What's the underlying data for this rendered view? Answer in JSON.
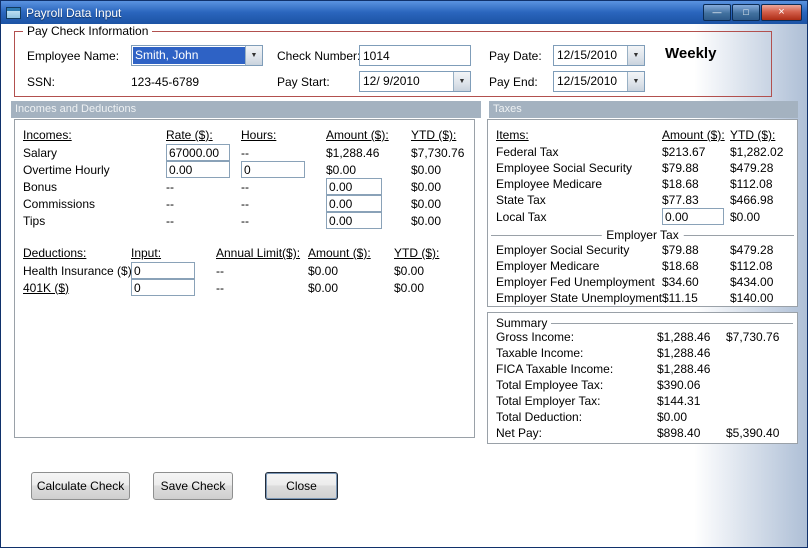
{
  "window": {
    "title": "Payroll Data Input"
  },
  "icons": {
    "dropdown_arrow": "▼",
    "minimize": "—",
    "maximize": "□",
    "close": "×"
  },
  "colors": {
    "titlebar_blue": "#2a65bd",
    "group_border_red": "#b2504e",
    "section_header_bg": "#a4b2c0",
    "selection_blue": "#2e62c5"
  },
  "paycheck": {
    "group_label": "Pay Check Information",
    "fields": {
      "employee_name": {
        "label": "Employee Name:",
        "value": "Smith, John"
      },
      "ssn": {
        "label": "SSN:",
        "value": "123-45-6789"
      },
      "check_number": {
        "label": "Check Number:",
        "value": "1014"
      },
      "pay_start": {
        "label": "Pay Start:",
        "value": "12/ 9/2010"
      },
      "pay_date": {
        "label": "Pay Date:",
        "value": "12/15/2010"
      },
      "pay_end": {
        "label": "Pay End:",
        "value": "12/15/2010"
      }
    },
    "frequency": "Weekly"
  },
  "section_headers": {
    "incomes_deductions": "Incomes and Deductions",
    "taxes": "Taxes"
  },
  "incomes": {
    "headers": {
      "item": "Incomes:",
      "rate": "Rate ($):",
      "hours": "Hours:",
      "amount": "Amount ($):",
      "ytd": "YTD ($):"
    },
    "salary": {
      "label": "Salary",
      "rate": "67000.00",
      "hours": "--",
      "amount": "$1,288.46",
      "ytd": "$7,730.76"
    },
    "overtime": {
      "label": "Overtime Hourly",
      "rate": "0.00",
      "hours": "0",
      "amount": "$0.00",
      "ytd": "$0.00"
    },
    "bonus": {
      "label": "Bonus",
      "rate": "--",
      "hours": "--",
      "amount": "0.00",
      "ytd": "$0.00"
    },
    "commissions": {
      "label": "Commissions",
      "rate": "--",
      "hours": "--",
      "amount": "0.00",
      "ytd": "$0.00"
    },
    "tips": {
      "label": "Tips",
      "rate": "--",
      "hours": "--",
      "amount": "0.00",
      "ytd": "$0.00"
    }
  },
  "deductions": {
    "headers": {
      "item": "Deductions:",
      "input": "Input:",
      "limit": "Annual Limit($):",
      "amount": "Amount ($):",
      "ytd": "YTD ($):"
    },
    "health": {
      "label": "Health Insurance ($)",
      "input": "0",
      "limit": "--",
      "amount": "$0.00",
      "ytd": "$0.00"
    },
    "k401": {
      "label": "401K ($)",
      "input": "0",
      "limit": "--",
      "amount": "$0.00",
      "ytd": "$0.00"
    }
  },
  "taxes": {
    "headers": {
      "item": "Items:",
      "amount": "Amount ($):",
      "ytd": "YTD ($):"
    },
    "rows": [
      {
        "label": "Federal Tax",
        "amount": "$213.67",
        "ytd": "$1,282.02"
      },
      {
        "label": "Employee Social Security",
        "amount": "$79.88",
        "ytd": "$479.28"
      },
      {
        "label": "Employee Medicare",
        "amount": "$18.68",
        "ytd": "$112.08"
      },
      {
        "label": "State Tax",
        "amount": "$77.83",
        "ytd": "$466.98"
      }
    ],
    "local_tax": {
      "label": "Local Tax",
      "amount": "0.00",
      "ytd": "$0.00"
    },
    "employer_header": "Employer Tax",
    "employer_rows": [
      {
        "label": "Employer Social Security",
        "amount": "$79.88",
        "ytd": "$479.28"
      },
      {
        "label": "Employer Medicare",
        "amount": "$18.68",
        "ytd": "$112.08"
      },
      {
        "label": "Employer Fed Unemployment",
        "amount": "$34.60",
        "ytd": "$434.00"
      },
      {
        "label": "Employer State Unemployment",
        "amount": "$11.15",
        "ytd": "$140.00"
      }
    ]
  },
  "summary": {
    "group_label": "Summary",
    "rows": [
      {
        "label": "Gross Income:",
        "amount": "$1,288.46",
        "ytd": "$7,730.76"
      },
      {
        "label": "Taxable Income:",
        "amount": "$1,288.46",
        "ytd": ""
      },
      {
        "label": "FICA Taxable Income:",
        "amount": "$1,288.46",
        "ytd": ""
      },
      {
        "label": "Total Employee Tax:",
        "amount": "$390.06",
        "ytd": ""
      },
      {
        "label": "Total Employer Tax:",
        "amount": "$144.31",
        "ytd": ""
      },
      {
        "label": "Total Deduction:",
        "amount": "$0.00",
        "ytd": ""
      },
      {
        "label": "Net Pay:",
        "amount": "$898.40",
        "ytd": "$5,390.40"
      }
    ]
  },
  "buttons": {
    "calculate": "Calculate Check",
    "save": "Save Check",
    "close": "Close"
  }
}
